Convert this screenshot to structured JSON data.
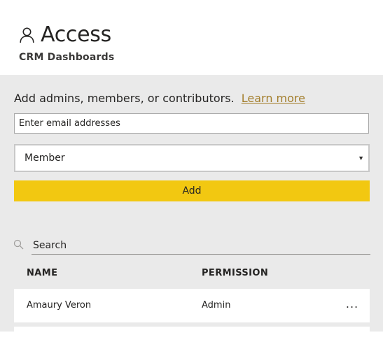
{
  "header": {
    "title": "Access",
    "subtitle": "CRM Dashboards",
    "icon": "person-icon"
  },
  "form": {
    "prompt": "Add admins, members, or contributors.",
    "learn_more": "Learn more",
    "email_placeholder": "Enter email addresses",
    "role_selected": "Member",
    "add_label": "Add",
    "accent_color": "#f2c811",
    "link_color": "#a37e2c"
  },
  "search": {
    "placeholder": "Search",
    "icon": "search-icon"
  },
  "table": {
    "columns": [
      "NAME",
      "PERMISSION"
    ],
    "rows": [
      {
        "name": "Amaury Veron",
        "permission": "Admin",
        "more": "..."
      },
      {
        "name": "",
        "permission": "",
        "more": ""
      }
    ]
  }
}
